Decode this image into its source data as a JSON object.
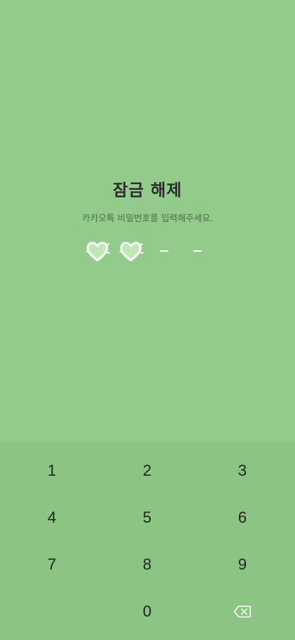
{
  "lock": {
    "title": "잠금 해제",
    "subtitle": "카카오톡 비밀번호를 입력해주세요.",
    "entered_count": 2,
    "pin_length": 4
  },
  "keypad": {
    "keys": [
      "1",
      "2",
      "3",
      "4",
      "5",
      "6",
      "7",
      "8",
      "9",
      "",
      "0",
      "backspace-icon"
    ]
  },
  "colors": {
    "background": "#92cc8a",
    "keypad_background": "#8bc583",
    "text": "#2b2b2b",
    "heart": "#ffffff"
  }
}
